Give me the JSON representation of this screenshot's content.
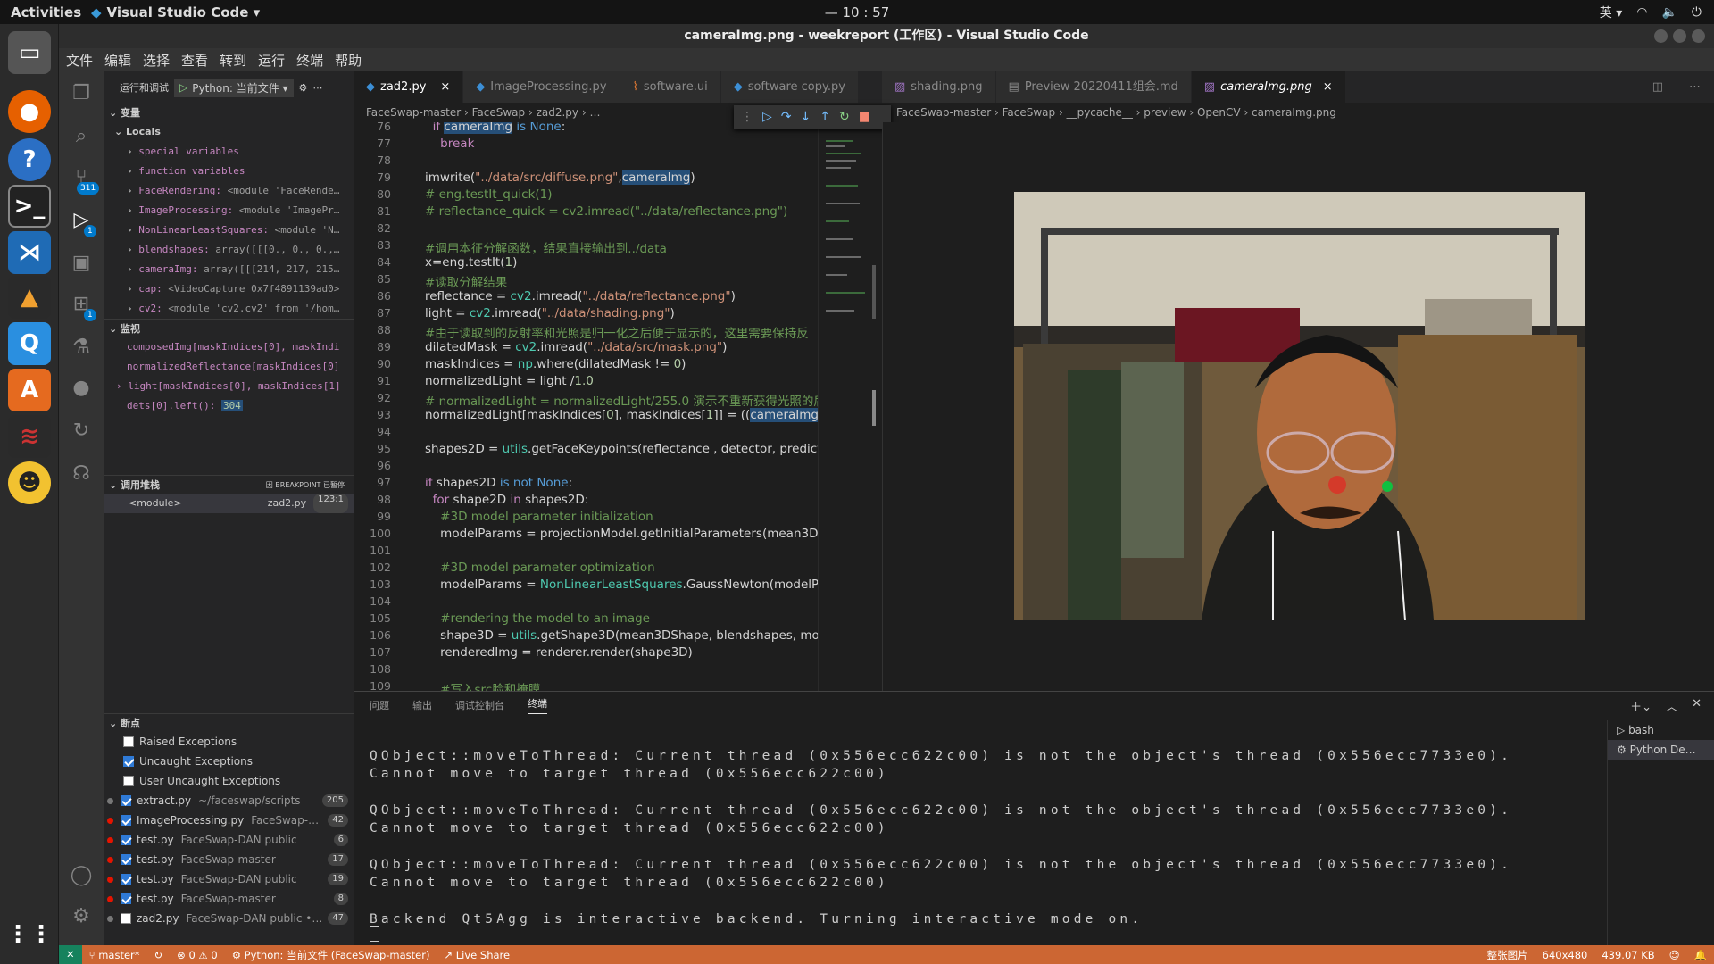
{
  "topbar": {
    "activities": "Activities",
    "app": "Visual Studio Code ▾",
    "clock": "— 10 : 57",
    "ime": "英 ▾"
  },
  "window": {
    "title": "cameraImg.png - weekreport (工作区) - Visual Studio Code"
  },
  "menu": [
    "文件",
    "编辑",
    "选择",
    "查看",
    "转到",
    "运行",
    "终端",
    "帮助"
  ],
  "activity": {
    "scm_badge": "311",
    "debug_badge": "1",
    "ext_badge": "1"
  },
  "sidebar": {
    "run_label": "运行和调试",
    "config": "Python: 当前文件 ▾",
    "variables_title": "变量",
    "locals_title": "Locals",
    "locals": [
      {
        "name": "special variables",
        "value": ""
      },
      {
        "name": "function variables",
        "value": ""
      },
      {
        "name": "FaceRendering:",
        "value": "<module 'FaceRende…"
      },
      {
        "name": "ImageProcessing:",
        "value": "<module 'ImagePr…"
      },
      {
        "name": "NonLinearLeastSquares:",
        "value": "<module 'N…"
      },
      {
        "name": "blendshapes:",
        "value": "array([[[0., 0., 0.,…"
      },
      {
        "name": "cameraImg:",
        "value": "array([[[214, 217, 215…"
      },
      {
        "name": "cap:",
        "value": "<VideoCapture 0x7f4891139ad0>"
      },
      {
        "name": "cv2:",
        "value": "<module 'cv2.cv2' from '/hom…"
      }
    ],
    "watch_title": "监视",
    "watch": [
      "composedImg[maskIndices[0], maskIndi",
      "normalizedReflectance[maskIndices[0]",
      "light[maskIndices[0], maskIndices[1]",
      "dets[0].left():"
    ],
    "watch_value": "304",
    "callstack_title": "调用堆栈",
    "callstack_status": "因 BREAKPOINT 已暂停",
    "frame": {
      "name": "<module>",
      "file": "zad2.py",
      "pos": "123:1"
    },
    "breakpoints_title": "断点",
    "exceptions": [
      {
        "label": "Raised Exceptions",
        "on": false
      },
      {
        "label": "Uncaught Exceptions",
        "on": true
      },
      {
        "label": "User Uncaught Exceptions",
        "on": false
      }
    ],
    "breakpoints": [
      {
        "file": "extract.py",
        "path": "~/faceswap/scripts",
        "line": "205",
        "on": true,
        "dot": "gray"
      },
      {
        "file": "ImageProcessing.py",
        "path": "FaceSwap-…",
        "line": "42",
        "on": true,
        "dot": "red"
      },
      {
        "file": "test.py",
        "path": "FaceSwap-DAN public",
        "line": "6",
        "on": true,
        "dot": "red"
      },
      {
        "file": "test.py",
        "path": "FaceSwap-master",
        "line": "17",
        "on": true,
        "dot": "red"
      },
      {
        "file": "test.py",
        "path": "FaceSwap-DAN public",
        "line": "19",
        "on": true,
        "dot": "red"
      },
      {
        "file": "test.py",
        "path": "FaceSwap-master",
        "line": "8",
        "on": true,
        "dot": "red"
      },
      {
        "file": "zad2.py",
        "path": "FaceSwap-DAN public •…",
        "line": "47",
        "on": false,
        "dot": "gray"
      }
    ]
  },
  "tabs_left": [
    "zad2.py",
    "ImageProcessing.py",
    "software.ui",
    "software copy.py"
  ],
  "tabs_right": [
    "shading.png",
    "Preview 20220411组会.md",
    "cameraImg.png"
  ],
  "crumb_left": "FaceSwap-master  ›  FaceSwap  ›  zad2.py  ›  …",
  "crumb_right": "FaceSwap-master  ›  FaceSwap  ›  __pycache__  ›  preview  ›  OpenCV  ›  cameraImg.png",
  "code_lines": [
    "76",
    "77",
    "78",
    "79",
    "80",
    "81",
    "82",
    "83",
    "84",
    "85",
    "86",
    "87",
    "88",
    "89",
    "90",
    "91",
    "92",
    "93",
    "94",
    "95",
    "96",
    "97",
    "98",
    "99",
    "100",
    "101",
    "102",
    "103",
    "104",
    "105",
    "106",
    "107",
    "108",
    "109"
  ],
  "panel": {
    "tabs": [
      "问题",
      "输出",
      "调试控制台",
      "终端"
    ],
    "term": [
      "QObject::moveToThread: Current thread (0x556ecc622c00) is not the object's thread (0x556ecc7733e0).",
      "Cannot move to target thread (0x556ecc622c00)",
      "",
      "QObject::moveToThread: Current thread (0x556ecc622c00) is not the object's thread (0x556ecc7733e0).",
      "Cannot move to target thread (0x556ecc622c00)",
      "",
      "QObject::moveToThread: Current thread (0x556ecc622c00) is not the object's thread (0x556ecc7733e0).",
      "Cannot move to target thread (0x556ecc622c00)",
      "",
      "Backend Qt5Agg is interactive backend. Turning interactive mode on."
    ],
    "terminals": [
      "bash",
      "Python De…"
    ]
  },
  "status": {
    "branch": "master*",
    "errors": "⊗ 0 ⚠ 0",
    "python": "Python: 当前文件 (FaceSwap-master)",
    "liveshare": "Live Share",
    "img": "整张图片",
    "dims": "640x480",
    "size": "439.07 KB"
  },
  "colors": {
    "statusbar": "#cc6633",
    "accent": "#007acc"
  }
}
